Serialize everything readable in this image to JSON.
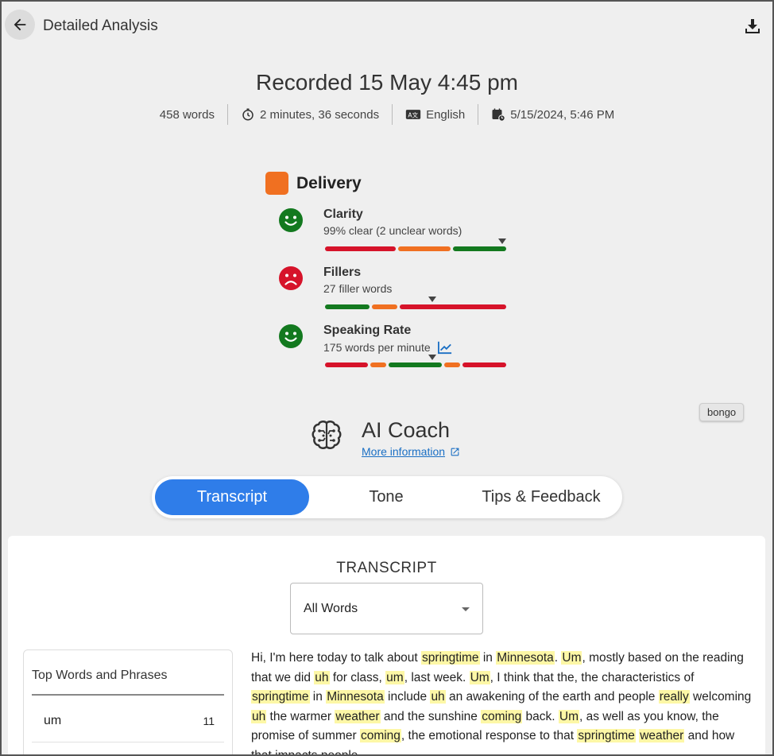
{
  "header": {
    "title": "Detailed Analysis"
  },
  "recording": {
    "title": "Recorded 15 May 4:45 pm",
    "words": "458 words",
    "duration": "2 minutes, 36 seconds",
    "language": "English",
    "date": "5/15/2024, 5:46 PM"
  },
  "delivery": {
    "title": "Delivery",
    "color": "#f07021",
    "metrics": [
      {
        "label": "Clarity",
        "sub": "99% clear (2 unclear words)",
        "mood": "happy",
        "pointer_fraction": 0.98
      },
      {
        "label": "Fillers",
        "sub": "27 filler words",
        "mood": "sad",
        "pointer_fraction": 0.59
      },
      {
        "label": "Speaking Rate",
        "sub": "175 words per minute",
        "mood": "happy",
        "pointer_fraction": 0.59
      }
    ]
  },
  "badge": {
    "label": "bongo"
  },
  "coach": {
    "title": "AI Coach",
    "link": "More information"
  },
  "tabs": [
    {
      "label": "Transcript",
      "active": true
    },
    {
      "label": "Tone",
      "active": false
    },
    {
      "label": "Tips & Feedback",
      "active": false
    }
  ],
  "transcript": {
    "heading": "TRANSCRIPT",
    "filter": "All Words",
    "top_words_title": "Top Words and Phrases",
    "top_words": [
      {
        "word": "um",
        "count": "11"
      }
    ],
    "segments": [
      {
        "t": "Hi, I'm here today to talk about "
      },
      {
        "t": "springtime",
        "h": true
      },
      {
        "t": " in "
      },
      {
        "t": "Minnesota",
        "h": true
      },
      {
        "t": ". "
      },
      {
        "t": "Um",
        "h": true
      },
      {
        "t": ", mostly based on the reading that we did "
      },
      {
        "t": "uh",
        "h": true
      },
      {
        "t": " for class, "
      },
      {
        "t": "um",
        "h": true
      },
      {
        "t": ", last week. "
      },
      {
        "t": "Um",
        "h": true
      },
      {
        "t": ", I think that the, the characteristics of "
      },
      {
        "t": "springtime",
        "h": true
      },
      {
        "t": " in "
      },
      {
        "t": "Minnesota",
        "h": true
      },
      {
        "t": " include "
      },
      {
        "t": "uh",
        "h": true
      },
      {
        "t": " an awakening of the earth and people "
      },
      {
        "t": "really",
        "h": true
      },
      {
        "t": " welcoming "
      },
      {
        "t": "uh",
        "h": true
      },
      {
        "t": " the warmer "
      },
      {
        "t": "weather",
        "h": true
      },
      {
        "t": " and the sunshine "
      },
      {
        "t": "coming",
        "h": true
      },
      {
        "t": " back. "
      },
      {
        "t": "Um",
        "h": true
      },
      {
        "t": ", as well as you know, the promise of summer "
      },
      {
        "t": "coming",
        "h": true
      },
      {
        "t": ", the emotional response to that "
      },
      {
        "t": "springtime",
        "h": true
      },
      {
        "t": " "
      },
      {
        "t": "weather",
        "h": true
      },
      {
        "t": " and how that impacts people."
      }
    ]
  },
  "colors": {
    "green": "#13791f",
    "orange": "#f07021",
    "red": "#d6132a",
    "highlight": "#fdf7a6",
    "accent": "#2f7de9"
  }
}
